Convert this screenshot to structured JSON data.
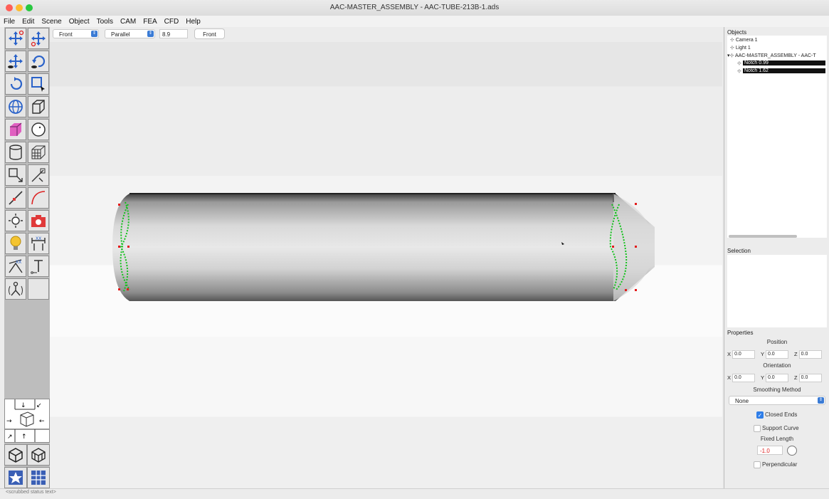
{
  "window": {
    "title": "AAC-MASTER_ASSEMBLY - AAC-TUBE-213B-1.ads",
    "traffic_colors": [
      "#ff5f57",
      "#febc2e",
      "#28c840"
    ]
  },
  "menu": [
    "File",
    "Edit",
    "Scene",
    "Object",
    "Tools",
    "CAM",
    "FEA",
    "CFD",
    "Help"
  ],
  "toolbar": {
    "view_select": "Front",
    "projection_select": "Parallel",
    "scale_value": "8.9",
    "view_button": "Front"
  },
  "tools": [
    "move-icon",
    "move-view-icon",
    "move-camera-icon",
    "rotate-view-icon",
    "rotate-icon",
    "select-region-icon",
    "globe-icon",
    "box-icon",
    "cube-solid-icon",
    "sphere-icon",
    "cylinder-icon",
    "mesh-icon",
    "scale-icon",
    "skew-icon",
    "line-icon",
    "curve-icon",
    "light-icon",
    "camera-icon",
    "bulb-icon",
    "dimension-icon",
    "angle-dimension-icon",
    "text-tool-icon",
    "joint-icon",
    "blank-tool"
  ],
  "bottom_tools": [
    "wireframe-cube-icon",
    "shaded-cube-icon",
    "star-icon",
    "grid-view-icon"
  ],
  "accent_color": "#3a7bd5",
  "objects_panel": {
    "title": "Objects",
    "items": [
      {
        "label": "Camera 1"
      },
      {
        "label": "Light 1"
      },
      {
        "label": "AAC-MASTER_ASSEMBLY - AAC-T"
      },
      {
        "label": "Notch 0.99",
        "selected": true
      },
      {
        "label": "Notch 1.62",
        "selected": true
      }
    ]
  },
  "selection_panel": {
    "title": "Selection"
  },
  "properties_panel": {
    "title": "Properties",
    "position_label": "Position",
    "position": {
      "x": "0.0",
      "y": "0.0",
      "z": "0.0"
    },
    "orientation_label": "Orientation",
    "orientation": {
      "x": "0.0",
      "y": "0.0",
      "z": "0.0"
    },
    "smoothing_label": "Smoothing Method",
    "smoothing_value": "None",
    "closed_ends_label": "Closed Ends",
    "closed_ends_checked": true,
    "support_curve_label": "Support Curve",
    "support_curve_checked": false,
    "fixed_length_label": "Fixed Length",
    "fixed_length_value": "-1.0",
    "perpendicular_label": "Perpendicular",
    "perpendicular_checked": false
  },
  "status_text": "<scrubbed status text>"
}
